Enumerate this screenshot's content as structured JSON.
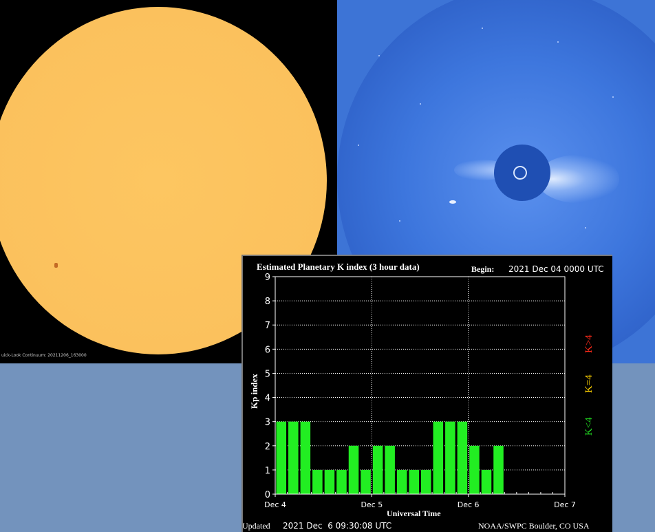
{
  "sdo": {
    "caption": "uick-Look Continuum: 20211206_163000"
  },
  "kp_chart": {
    "begin_label": "Begin:",
    "begin_value": "2021 Dec 04 0000 UTC",
    "updated_label": "Updated",
    "updated_value": "2021 Dec  6 09:30:08 UTC",
    "credit": "NOAA/SWPC Boulder, CO USA",
    "legend": [
      {
        "label": "K>4",
        "color": "#ff2a1a"
      },
      {
        "label": "K=4",
        "color": "#ffd200"
      },
      {
        "label": "K<4",
        "color": "#22dd22"
      }
    ],
    "colors": {
      "bar": "#22ee22",
      "axis": "#ffffff",
      "grid": "#ffffff",
      "background": "#000000"
    }
  },
  "chart_data": {
    "type": "bar",
    "title": "Estimated Planetary K index (3 hour data)",
    "xlabel": "Universal Time",
    "ylabel": "Kp index",
    "ylim": [
      0,
      9
    ],
    "yticks": [
      0,
      1,
      2,
      3,
      4,
      5,
      6,
      7,
      8,
      9
    ],
    "xticks": [
      "Dec 4",
      "Dec 5",
      "Dec 6",
      "Dec 7"
    ],
    "bins_per_day": 8,
    "grid": "dotted, at each day and each integer Kp",
    "values": [
      3,
      3,
      3,
      1,
      1,
      1,
      2,
      1,
      2,
      2,
      1,
      1,
      1,
      3,
      3,
      3,
      2,
      1,
      2
    ]
  }
}
